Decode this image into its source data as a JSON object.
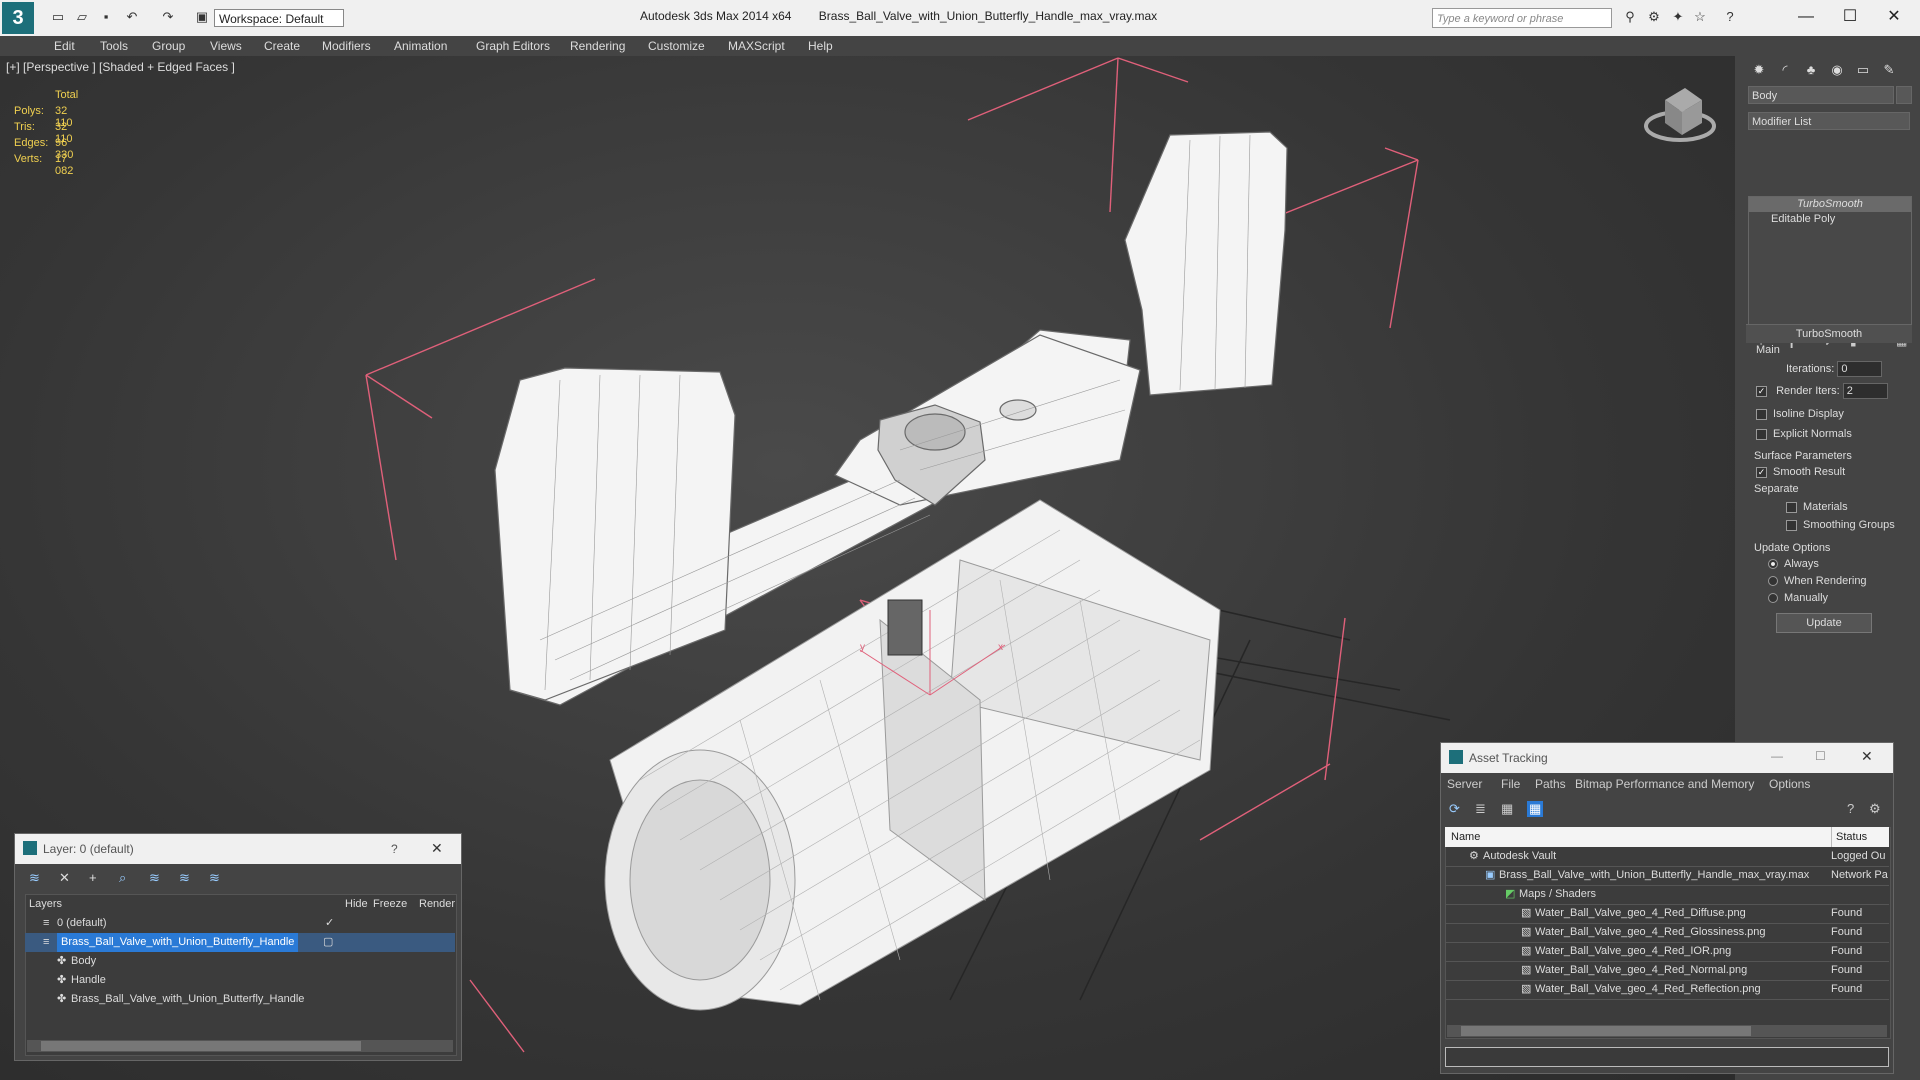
{
  "titlebar": {
    "app": "Autodesk 3ds Max  2014 x64",
    "file": "Brass_Ball_Valve_with_Union_Butterfly_Handle_max_vray.max",
    "workspace": "Workspace: Default",
    "search_placeholder": "Type a keyword or phrase"
  },
  "menu": [
    "Edit",
    "Tools",
    "Group",
    "Views",
    "Create",
    "Modifiers",
    "Animation",
    "Graph Editors",
    "Rendering",
    "Customize",
    "MAXScript",
    "Help"
  ],
  "viewport": {
    "label": "[+] [Perspective ] [Shaded + Edged Faces ]",
    "stats": {
      "header": "Total",
      "rows": [
        {
          "label": "Polys:",
          "value": "32 110"
        },
        {
          "label": "Tris:",
          "value": "32 110"
        },
        {
          "label": "Edges:",
          "value": "96 330"
        },
        {
          "label": "Verts:",
          "value": "17 082"
        }
      ]
    },
    "axis_x": "x",
    "axis_y": "y"
  },
  "command_panel": {
    "object_name": "Body",
    "modifier_list": "Modifier List",
    "stack": [
      "TurboSmooth",
      "Editable Poly"
    ],
    "rollout_title": "TurboSmooth",
    "main_label": "Main",
    "iterations_label": "Iterations:",
    "iterations_value": "0",
    "render_iters_label": "Render Iters:",
    "render_iters_value": "2",
    "isoline": "Isoline Display",
    "explicit_normals": "Explicit Normals",
    "surface_params": "Surface Parameters",
    "smooth_result": "Smooth Result",
    "separate": "Separate",
    "materials": "Materials",
    "smoothing_groups": "Smoothing Groups",
    "update_options": "Update Options",
    "always": "Always",
    "when_rendering": "When Rendering",
    "manually": "Manually",
    "update_btn": "Update"
  },
  "layer_window": {
    "title": "Layer: 0 (default)",
    "help": "?",
    "cols": {
      "layers": "Layers",
      "hide": "Hide",
      "freeze": "Freeze",
      "render": "Render"
    },
    "rows": [
      {
        "name": "0 (default)"
      },
      {
        "name": "Brass_Ball_Valve_with_Union_Butterfly_Handle"
      },
      {
        "name": "Body"
      },
      {
        "name": "Handle"
      },
      {
        "name": "Brass_Ball_Valve_with_Union_Butterfly_Handle"
      }
    ]
  },
  "asset_window": {
    "title": "Asset Tracking",
    "menu": [
      "Server",
      "File",
      "Paths",
      "Bitmap Performance and Memory",
      "Options"
    ],
    "cols": {
      "name": "Name",
      "status": "Status"
    },
    "rows": [
      {
        "name": "Autodesk Vault",
        "status": "Logged Ou"
      },
      {
        "name": "Brass_Ball_Valve_with_Union_Butterfly_Handle_max_vray.max",
        "status": "Network Pa"
      },
      {
        "name": "Maps / Shaders",
        "status": ""
      },
      {
        "name": "Water_Ball_Valve_geo_4_Red_Diffuse.png",
        "status": "Found"
      },
      {
        "name": "Water_Ball_Valve_geo_4_Red_Glossiness.png",
        "status": "Found"
      },
      {
        "name": "Water_Ball_Valve_geo_4_Red_IOR.png",
        "status": "Found"
      },
      {
        "name": "Water_Ball_Valve_geo_4_Red_Normal.png",
        "status": "Found"
      },
      {
        "name": "Water_Ball_Valve_geo_4_Red_Reflection.png",
        "status": "Found"
      }
    ]
  }
}
